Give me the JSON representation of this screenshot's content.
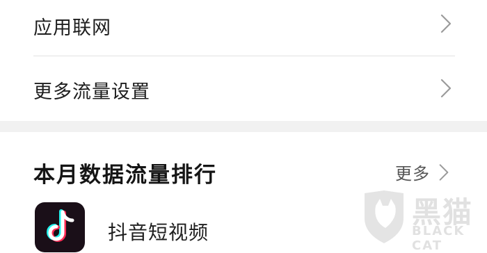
{
  "settings": {
    "items": [
      {
        "label": "应用联网",
        "icon": "chevron-right-icon"
      },
      {
        "label": "更多流量设置",
        "icon": "chevron-right-icon"
      }
    ]
  },
  "ranking": {
    "title": "本月数据流量排行",
    "more_label": "更多",
    "apps": [
      {
        "name": "抖音短视频",
        "icon": "douyin-app-icon"
      }
    ]
  },
  "watermark": {
    "text_cn": "黑猫",
    "text_en": "BLACK CAT"
  },
  "colors": {
    "background": "#ffffff",
    "section_gap": "#f1f1f1",
    "divider": "#e2e2e2",
    "chevron": "#9a9a9a"
  }
}
